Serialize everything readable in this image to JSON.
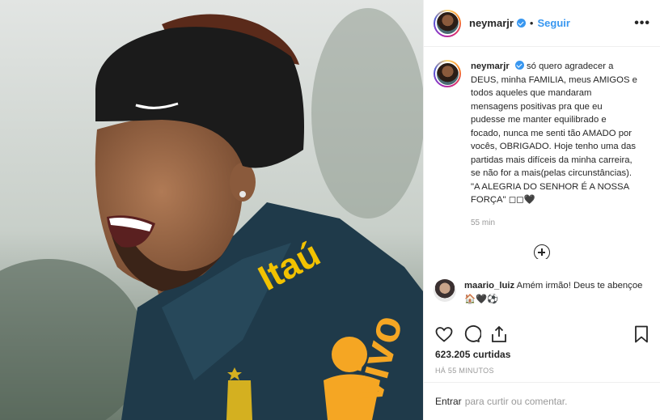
{
  "post": {
    "username": "neymarjr",
    "follow_label": "Seguir",
    "separator": "•",
    "more_label": "•••"
  },
  "caption": {
    "username": "neymarjr",
    "text": "só quero agradecer a DEUS, minha FAMILIA, meus AMIGOS e todos aqueles que mandaram mensagens positivas pra que eu pudesse me manter equilibrado e focado, nunca me senti tão AMADO por vocês, OBRIGADO. Hoje tenho uma das partidas mais difíceis da minha carreira, se não for a mais(pelas circunstâncias). \"A ALEGRIA DO SENHOR É A NOSSA FORÇA\" ◻◻🖤",
    "time": "55 min"
  },
  "reply": {
    "username": "maario_luiz",
    "text": "Amém irmão! Deus te abençoe 🏠🖤⚽"
  },
  "stats": {
    "likes": "623.205 curtidas",
    "time_ago": "HÁ 55 MINUTOS"
  },
  "comment_box": {
    "link": "Entrar",
    "placeholder": "para curtir ou comentar."
  },
  "colors": {
    "accent": "#3897f0",
    "text": "#262626",
    "muted": "#999999",
    "jersey": "#1f3a4a",
    "logo_orange": "#f5a623"
  },
  "photo": {
    "shirt_text": "Itaú",
    "sponsor_text": "vivo"
  }
}
